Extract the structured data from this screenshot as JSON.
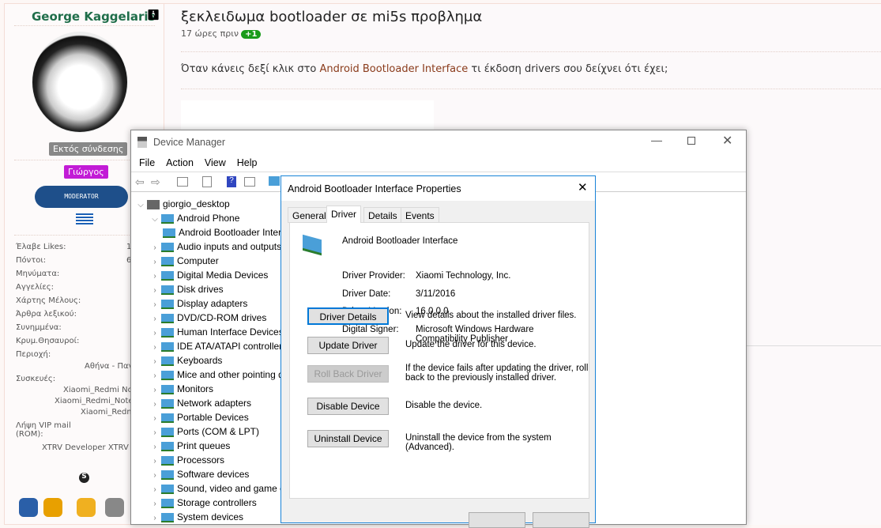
{
  "profile": {
    "name": "George Kaggelaris",
    "status": "Εκτός σύνδεσης",
    "group": "Γιώργος",
    "moderator": "MODERATOR",
    "stats": [
      {
        "label": "Έλαβε Likes:",
        "value": "1"
      },
      {
        "label": "Πόντοι:",
        "value": "6"
      },
      {
        "label": "Μηνύματα:",
        "value": ""
      },
      {
        "label": "Αγγελίες:",
        "value": ""
      },
      {
        "label": "Χάρτης Μέλους:",
        "value": ""
      },
      {
        "label": "Άρθρα λεξικού:",
        "value": ""
      },
      {
        "label": "Συνημμένα:",
        "value": ""
      },
      {
        "label": "Κρυμ.Θησαυροί:",
        "value": ""
      }
    ],
    "region_label": "Περιοχή:",
    "region": "Αθήνα - Παγ",
    "devices_label": "Συσκευές:",
    "devices": [
      "Xiaomi_Redmi No",
      "Xiaomi_Redmi_Note",
      "Xiaomi_Redm"
    ],
    "vip_label": "Λήψη VIP mail (ROM):",
    "vip": "XTRV Developer XTRV S"
  },
  "post": {
    "title": "ξεκλειδωμα bootloader σε mi5s προβλημα",
    "ago": "17 ώρες πριν",
    "plus": "+1",
    "text_before": "Όταν κάνεις δεξί κλικ στο ",
    "link": "Android Bootloader Interface",
    "text_after": " τι έκδοση drivers σου δείχνει ότι έχει;"
  },
  "device_manager": {
    "title": "Device Manager",
    "menu": [
      "File",
      "Action",
      "View",
      "Help"
    ],
    "root": "giorgio_desktop",
    "tree": [
      {
        "label": "Android Phone",
        "level": 1,
        "open": true
      },
      {
        "label": "Android Bootloader Interface",
        "level": 2
      },
      {
        "label": "Audio inputs and outputs",
        "level": 1
      },
      {
        "label": "Computer",
        "level": 1
      },
      {
        "label": "Digital Media Devices",
        "level": 1
      },
      {
        "label": "Disk drives",
        "level": 1
      },
      {
        "label": "Display adapters",
        "level": 1
      },
      {
        "label": "DVD/CD-ROM drives",
        "level": 1
      },
      {
        "label": "Human Interface Devices",
        "level": 1
      },
      {
        "label": "IDE ATA/ATAPI controllers",
        "level": 1
      },
      {
        "label": "Keyboards",
        "level": 1
      },
      {
        "label": "Mice and other pointing devices",
        "level": 1
      },
      {
        "label": "Monitors",
        "level": 1
      },
      {
        "label": "Network adapters",
        "level": 1
      },
      {
        "label": "Portable Devices",
        "level": 1
      },
      {
        "label": "Ports (COM & LPT)",
        "level": 1
      },
      {
        "label": "Print queues",
        "level": 1
      },
      {
        "label": "Processors",
        "level": 1
      },
      {
        "label": "Software devices",
        "level": 1
      },
      {
        "label": "Sound, video and game controllers",
        "level": 1
      },
      {
        "label": "Storage controllers",
        "level": 1
      },
      {
        "label": "System devices",
        "level": 1
      }
    ]
  },
  "dialog": {
    "title": "Android Bootloader Interface Properties",
    "tabs": [
      "General",
      "Driver",
      "Details",
      "Events"
    ],
    "active_tab": "Driver",
    "device": "Android Bootloader Interface",
    "fields": [
      {
        "label": "Driver Provider:",
        "value": "Xiaomi Technology, Inc."
      },
      {
        "label": "Driver Date:",
        "value": "3/11/2016"
      },
      {
        "label": "Driver Version:",
        "value": "16.0.0.0"
      },
      {
        "label": "Digital Signer:",
        "value": "Microsoft Windows Hardware Compatibility Publisher"
      }
    ],
    "actions": [
      {
        "button": "Driver Details",
        "desc": "View details about the installed driver files."
      },
      {
        "button": "Update Driver",
        "desc": "Update the driver for this device."
      },
      {
        "button": "Roll Back Driver",
        "desc": "If the device fails after updating the driver, roll back to the previously installed driver.",
        "disabled": true
      },
      {
        "button": "Disable Device",
        "desc": "Disable the device."
      },
      {
        "button": "Uninstall Device",
        "desc": "Uninstall the device from the system (Advanced)."
      }
    ]
  }
}
